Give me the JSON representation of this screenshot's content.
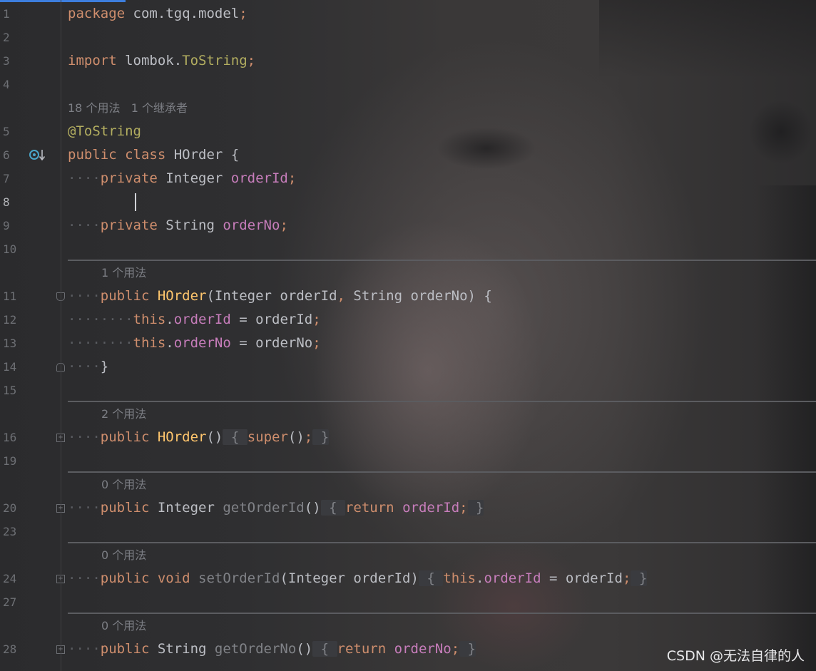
{
  "gutter": {
    "line_numbers": [
      "1",
      "2",
      "3",
      "4",
      "5",
      "6",
      "7",
      "8",
      "9",
      "10",
      "11",
      "12",
      "13",
      "14",
      "15",
      "16",
      "19",
      "20",
      "23",
      "24",
      "27",
      "28"
    ],
    "active_line": "8"
  },
  "code": {
    "l1": {
      "kw": "package",
      "rest": " com.tgq.model",
      "semi": ";"
    },
    "l3": {
      "kw": "import",
      "pkg": " lombok.",
      "cls": "ToString",
      "semi": ";"
    },
    "usage_class": "18 个用法   1 个继承者",
    "l5": {
      "annotation": "@ToString"
    },
    "l6": {
      "kw1": "public",
      "kw2": " class",
      "name": " HOrder",
      "brace": " {"
    },
    "l7": {
      "indent": "····",
      "kw": "private",
      "type": " Integer",
      "field": " orderId",
      "semi": ";"
    },
    "l9": {
      "indent": "····",
      "kw": "private",
      "type": " String",
      "field": " orderNo",
      "semi": ";"
    },
    "usage_ctor1": "1 个用法",
    "l11": {
      "indent": "····",
      "kw": "public",
      "name": " HOrder",
      "p1": "(Integer orderId",
      "comma": ",",
      "p2": " String orderNo) {"
    },
    "l12": {
      "indent": "········",
      "this": "this",
      "dot": ".",
      "field": "orderId",
      "rest": " = orderId",
      "semi": ";"
    },
    "l13": {
      "indent": "········",
      "this": "this",
      "dot": ".",
      "field": "orderNo",
      "rest": " = orderNo",
      "semi": ";"
    },
    "l14": {
      "indent": "····",
      "brace": "}"
    },
    "usage_ctor2": "2 个用法",
    "l16": {
      "indent": "····",
      "kw": "public",
      "name": " HOrder",
      "parens": "()",
      "open": " { ",
      "super": "super",
      "call": "()",
      "semi": ";",
      "close": " }"
    },
    "usage_get_id": "0 个用法",
    "l20": {
      "indent": "····",
      "kw": "public",
      "type": " Integer",
      "name": " getOrderId",
      "parens": "()",
      "open": " { ",
      "ret": "return",
      "field": " orderId",
      "semi": ";",
      "close": " }"
    },
    "usage_set_id": "0 个用法",
    "l24": {
      "indent": "····",
      "kw1": "public",
      "kw2": " void",
      "name": " setOrderId",
      "params": "(Integer orderId)",
      "open": " { ",
      "this": "this",
      "dot": ".",
      "field": "orderId",
      "rest": " = orderId",
      "semi": ";",
      "close": " }"
    },
    "usage_get_no": "0 个用法",
    "l28": {
      "indent": "····",
      "kw": "public",
      "type": " String",
      "name": " getOrderNo",
      "parens": "()",
      "open": " { ",
      "ret": "return",
      "field": " orderNo",
      "semi": ";",
      "close": " }"
    }
  },
  "watermark": "CSDN @无法自律的人",
  "colors": {
    "keyword": "#cf8e6d",
    "annotation": "#b3ae60",
    "field": "#c77dbb",
    "method_call": "#ffc66d",
    "line_number": "#6e7075",
    "accent": "#3d7ede"
  }
}
